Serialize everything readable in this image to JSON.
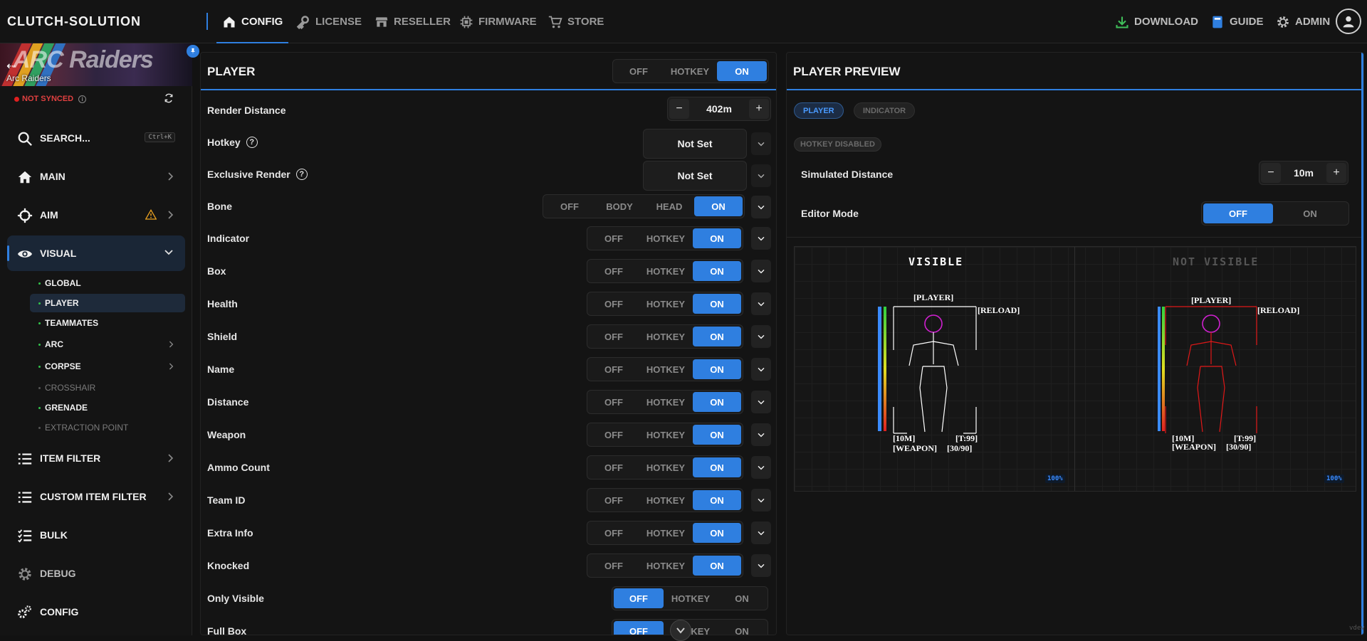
{
  "app": {
    "brand": "CLUTCH-SOLUTION",
    "accent": "#2f7fe0"
  },
  "nav": {
    "tabs": [
      {
        "label": "CONFIG",
        "icon": "home-icon"
      },
      {
        "label": "LICENSE",
        "icon": "key-icon"
      },
      {
        "label": "RESELLER",
        "icon": "store-icon"
      },
      {
        "label": "FIRMWARE",
        "icon": "chip-icon"
      },
      {
        "label": "STORE",
        "icon": "cart-icon"
      }
    ],
    "right": [
      {
        "label": "DOWNLOAD",
        "icon": "download-icon"
      },
      {
        "label": "GUIDE",
        "icon": "book-icon"
      },
      {
        "label": "ADMIN",
        "icon": "gear-icon"
      }
    ]
  },
  "sidebar": {
    "game": {
      "name": "Arc Raiders",
      "art_text": "ARC Raiders"
    },
    "sync_status": "NOT SYNCED",
    "search_label": "SEARCH...",
    "search_shortcut": "Ctrl+K",
    "items": [
      {
        "label": "MAIN",
        "icon": "home-icon"
      },
      {
        "label": "AIM",
        "icon": "crosshair-icon",
        "warning": true
      },
      {
        "label": "VISUAL",
        "icon": "eye-icon"
      },
      {
        "label": "ITEM FILTER",
        "icon": "list-icon"
      },
      {
        "label": "CUSTOM ITEM FILTER",
        "icon": "list-icon"
      },
      {
        "label": "BULK",
        "icon": "checklist-icon"
      },
      {
        "label": "DEBUG",
        "icon": "gear-icon"
      },
      {
        "label": "CONFIG",
        "icon": "gears-icon"
      }
    ],
    "visual_sub": [
      {
        "label": "GLOBAL",
        "enabled": true
      },
      {
        "label": "PLAYER",
        "enabled": true
      },
      {
        "label": "TEAMMATES",
        "enabled": true
      },
      {
        "label": "ARC",
        "enabled": true,
        "has_children": true
      },
      {
        "label": "CORPSE",
        "enabled": true,
        "has_children": true
      },
      {
        "label": "CROSSHAIR",
        "enabled": false
      },
      {
        "label": "GRENADE",
        "enabled": true
      },
      {
        "label": "EXTRACTION POINT",
        "enabled": false
      }
    ]
  },
  "player": {
    "title": "PLAYER",
    "master": {
      "options": [
        "OFF",
        "HOTKEY",
        "ON"
      ],
      "selected": "ON"
    },
    "render_distance": {
      "label": "Render Distance",
      "value": "402m",
      "minus": "−",
      "plus": "+"
    },
    "hotkey": {
      "label": "Hotkey",
      "value": "Not Set"
    },
    "exclusive_render": {
      "label": "Exclusive Render",
      "value": "Not Set"
    },
    "bone": {
      "label": "Bone",
      "options": [
        "OFF",
        "BODY",
        "HEAD",
        "ON"
      ],
      "selected": "ON"
    },
    "rows": [
      {
        "label": "Indicator",
        "selected": "ON"
      },
      {
        "label": "Box",
        "selected": "ON"
      },
      {
        "label": "Health",
        "selected": "ON"
      },
      {
        "label": "Shield",
        "selected": "ON"
      },
      {
        "label": "Name",
        "selected": "ON"
      },
      {
        "label": "Distance",
        "selected": "ON"
      },
      {
        "label": "Weapon",
        "selected": "ON"
      },
      {
        "label": "Ammo Count",
        "selected": "ON"
      },
      {
        "label": "Team ID",
        "selected": "ON"
      },
      {
        "label": "Extra Info",
        "selected": "ON"
      },
      {
        "label": "Knocked",
        "selected": "ON"
      }
    ],
    "plain_rows": [
      {
        "label": "Only Visible",
        "selected": "OFF"
      },
      {
        "label": "Full Box",
        "selected": "OFF"
      }
    ],
    "tri_options": [
      "OFF",
      "HOTKEY",
      "ON"
    ]
  },
  "preview": {
    "title": "PLAYER PREVIEW",
    "tabs": [
      "PLAYER",
      "INDICATOR"
    ],
    "hotkey_badge": "HOTKEY DISABLED",
    "simulated_distance": {
      "label": "Simulated Distance",
      "value": "10m",
      "minus": "−",
      "plus": "+"
    },
    "editor_mode": {
      "label": "Editor Mode",
      "options": [
        "OFF",
        "ON"
      ],
      "selected": "OFF"
    },
    "visible": {
      "heading": "VISIBLE",
      "color": "#ffffff",
      "box_color": "#ffffff",
      "head_color": "#d020d0"
    },
    "not_visible": {
      "heading": "NOT VISIBLE",
      "color": "#555555",
      "box_color": "#e01818",
      "head_color": "#d020d0"
    },
    "tags": {
      "player": "[PLAYER]",
      "reload": "[RELOAD]",
      "distance": "[10M]",
      "team": "[T:99]",
      "weapon": "[WEAPON]",
      "ammo": "[30/90]"
    },
    "zoom": "100%"
  },
  "footer": "vdev"
}
